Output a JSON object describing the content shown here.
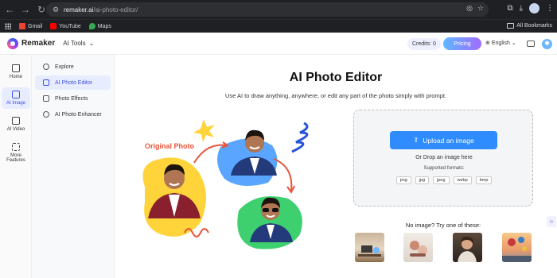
{
  "browser": {
    "url_domain": "remaker.ai",
    "url_path": "/ai-photo-editor/",
    "bookmarks": [
      {
        "label": "Gmail",
        "color": "#ea4335"
      },
      {
        "label": "YouTube",
        "color": "#ff0000"
      },
      {
        "label": "Maps",
        "color": "#34a853"
      }
    ],
    "all_bookmarks": "All Bookmarks"
  },
  "header": {
    "brand": "Remaker",
    "ai_tools": "AI Tools",
    "credits": "Credits: 0",
    "pricing": "Pricing",
    "language": "English"
  },
  "rail": {
    "items": [
      {
        "label": "Home",
        "active": false
      },
      {
        "label": "AI Image",
        "active": true
      },
      {
        "label": "AI Video",
        "active": false
      },
      {
        "label": "More Features",
        "active": false
      }
    ]
  },
  "subnav": {
    "items": [
      {
        "label": "Explore",
        "active": false
      },
      {
        "label": "AI Photo Editor",
        "active": true
      },
      {
        "label": "Photo Effects",
        "active": false
      },
      {
        "label": "AI Photo Enhancer",
        "active": false
      }
    ]
  },
  "main": {
    "title": "AI Photo Editor",
    "subtitle": "Use AI to draw anything, anywhere, or edit any part of the photo simply with prompt.",
    "illustration_label": "Original Photo",
    "upload_button": "Upload an image",
    "drop_text": "Or Drop an image here",
    "formats_label": "Supported formats:",
    "formats": [
      "png",
      "jpg",
      "jpeg",
      "webp",
      "bmp"
    ],
    "try_label": "No image? Try one of these:"
  },
  "colors": {
    "accent": "#2f8cff",
    "active_bg": "#e8ecff",
    "active_text": "#3b52e8",
    "orange": "#e8533a"
  }
}
